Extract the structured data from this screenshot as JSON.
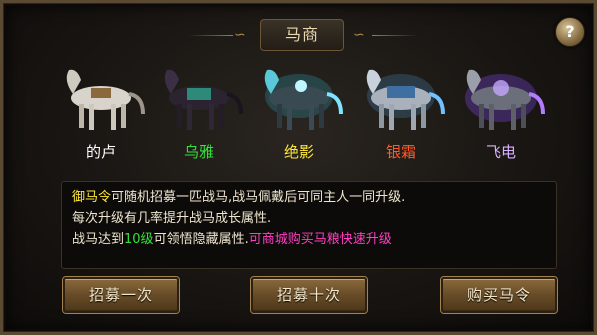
{
  "title": "马商",
  "help_label": "?",
  "horses": [
    {
      "name": "的卢",
      "color": "#ffffff",
      "icon": "white-horse-icon"
    },
    {
      "name": "乌雅",
      "color": "#34e23a",
      "icon": "black-horse-icon"
    },
    {
      "name": "绝影",
      "color": "#ffe93c",
      "icon": "cyan-glow-horse-icon"
    },
    {
      "name": "银霜",
      "color": "#ff5a2a",
      "icon": "silver-armored-horse-icon"
    },
    {
      "name": "飞电",
      "color": "#d8b0ff",
      "icon": "purple-armored-horse-icon"
    }
  ],
  "description": {
    "line1_highlight": "御马令",
    "line1_text": "可随机招募一匹战马,战马佩戴后可同主人一同升级.",
    "line2": "每次升级有几率提升战马成长属性.",
    "line3_prefix": "战马达到",
    "line3_level": "10级",
    "line3_suffix": "可领悟隐藏属性.",
    "line3_pink": "可商城购买马粮快速升级"
  },
  "buttons": {
    "recruit_once": "招募一次",
    "recruit_ten": "招募十次",
    "buy_token": "购买马令"
  }
}
